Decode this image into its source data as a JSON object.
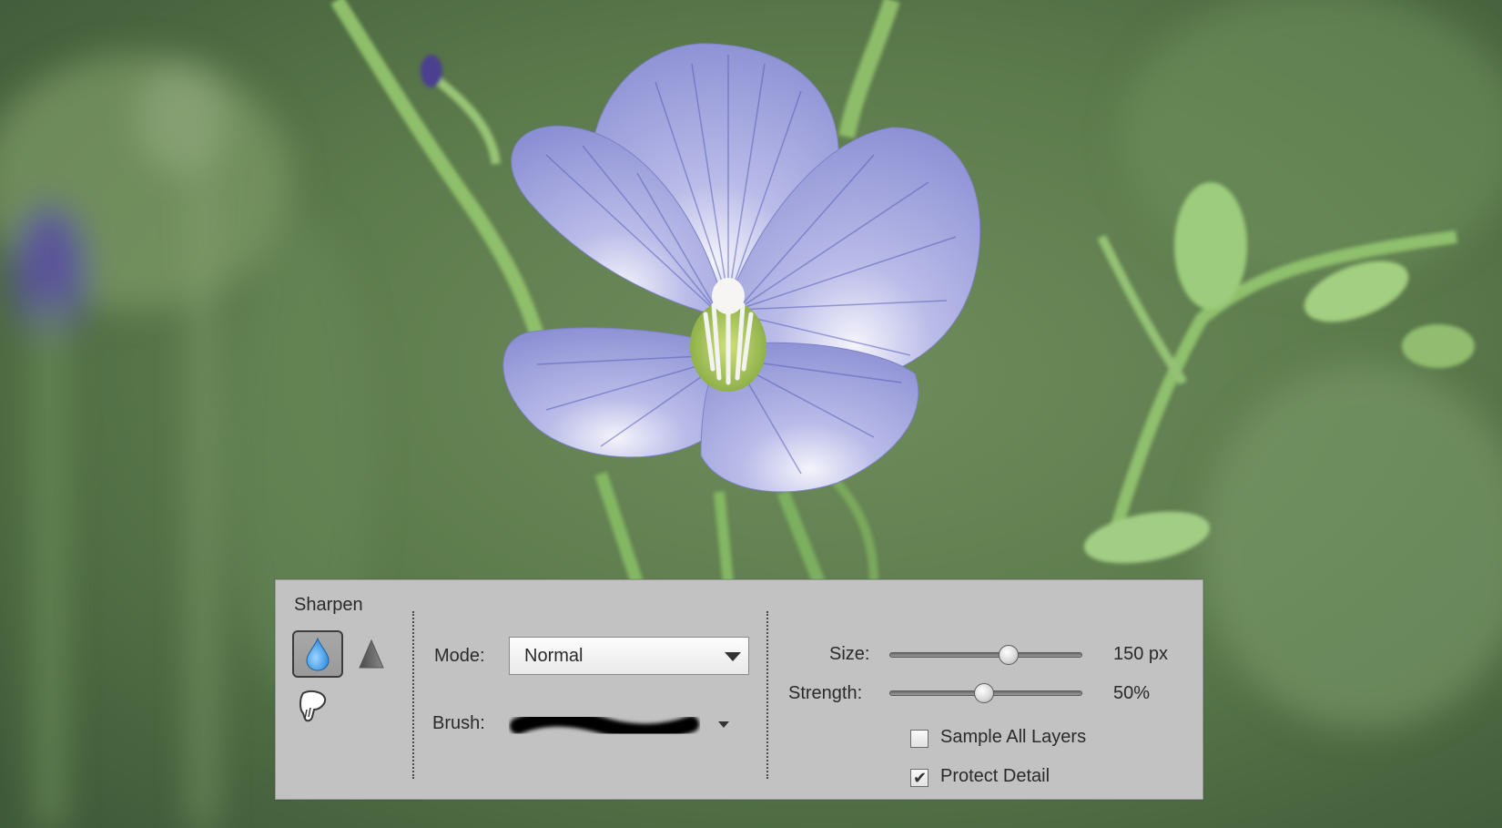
{
  "tool_options": {
    "tool_name": "Sharpen",
    "tools": {
      "active": "blur-tool",
      "items": [
        "blur-icon",
        "sharpen-icon",
        "smudge-icon"
      ]
    },
    "mode": {
      "label": "Mode:",
      "value": "Normal"
    },
    "brush": {
      "label": "Brush:"
    },
    "size": {
      "label": "Size:",
      "value": "150 px",
      "slider_fraction": 0.62
    },
    "strength": {
      "label": "Strength:",
      "value": "50%",
      "slider_fraction": 0.49
    },
    "sample_all_layers": {
      "label": "Sample All Layers",
      "checked": false
    },
    "protect_detail": {
      "label": "Protect Detail",
      "checked": true
    }
  },
  "colors": {
    "panel_bg": "#c2c2c2",
    "flower_petal": "#8e93d6",
    "background_green": "#5e7f4e",
    "blur_drop": "#3b9ee6"
  }
}
